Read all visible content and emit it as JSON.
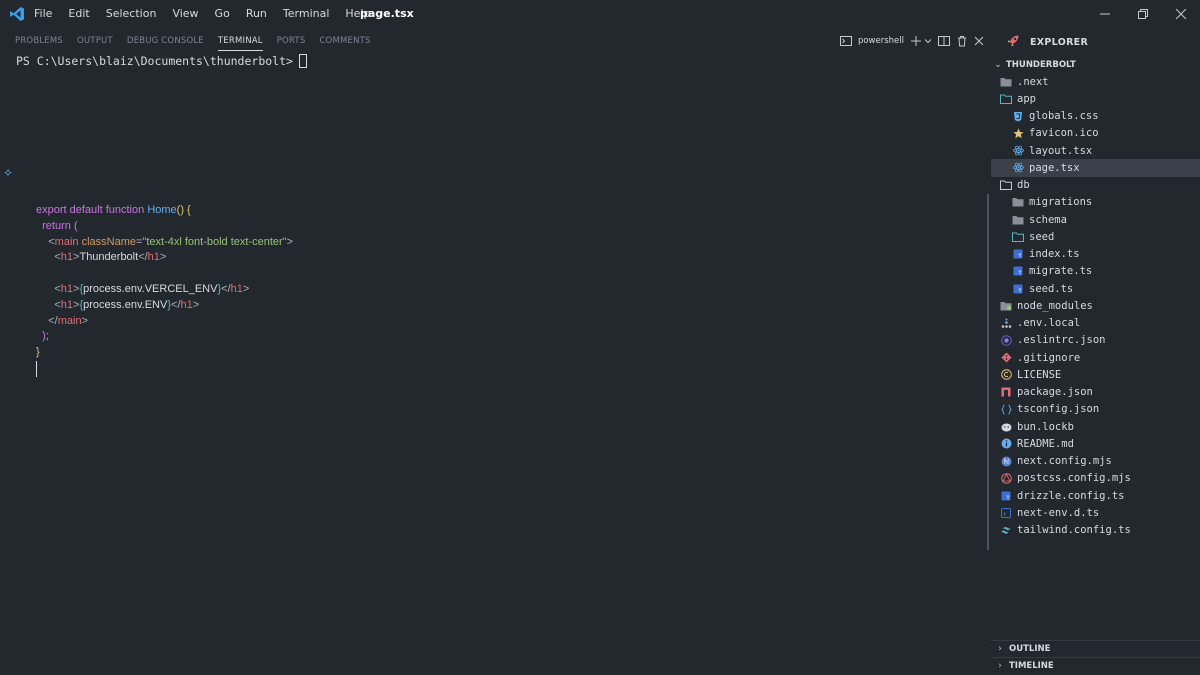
{
  "menu": [
    "File",
    "Edit",
    "Selection",
    "View",
    "Go",
    "Run",
    "Terminal",
    "Help"
  ],
  "window_title": "page.tsx",
  "panel": {
    "tabs": [
      "PROBLEMS",
      "OUTPUT",
      "DEBUG CONSOLE",
      "TERMINAL",
      "PORTS",
      "COMMENTS"
    ],
    "active_tab": "TERMINAL",
    "shell": "powershell"
  },
  "terminal": {
    "prompt": "PS C:\\Users\\blaiz\\Documents\\thunderbolt>"
  },
  "code": {
    "l1_kw": "export default function",
    "l1_fn": "Home",
    "l2_kw": "return",
    "l3_tag": "main",
    "l3_attr": "className",
    "l3_str": "\"text-4xl font-bold text-center\"",
    "l4_tag": "h1",
    "l4_text": "Thunderbolt",
    "l6_tag": "h1",
    "l6_var": "process.env.VERCEL_ENV",
    "l7_tag": "h1",
    "l7_var": "process.env.ENV",
    "l8_tag": "main"
  },
  "explorer": {
    "title": "EXPLORER",
    "project": "THUNDERBOLT",
    "items": [
      {
        "name": ".next",
        "depth": 0,
        "icon": "folder-closed-icon",
        "color": "#8a909a"
      },
      {
        "name": "app",
        "depth": 0,
        "icon": "folder-open-icon",
        "color": "#56b6c2"
      },
      {
        "name": "globals.css",
        "depth": 1,
        "icon": "css-shield-icon",
        "color": "#61afef"
      },
      {
        "name": "favicon.ico",
        "depth": 1,
        "icon": "star-icon",
        "color": "#e5c07b"
      },
      {
        "name": "layout.tsx",
        "depth": 1,
        "icon": "react-atom-icon",
        "color": "#61afef"
      },
      {
        "name": "page.tsx",
        "depth": 1,
        "icon": "react-atom-icon",
        "color": "#61afef",
        "selected": true
      },
      {
        "name": "db",
        "depth": 0,
        "icon": "folder-open-icon",
        "color": "#c5c8ce"
      },
      {
        "name": "migrations",
        "depth": 1,
        "icon": "folder-closed-icon",
        "color": "#8a909a"
      },
      {
        "name": "schema",
        "depth": 1,
        "icon": "folder-closed-icon",
        "color": "#8a909a"
      },
      {
        "name": "seed",
        "depth": 1,
        "icon": "folder-open-icon",
        "color": "#56b6c2"
      },
      {
        "name": "index.ts",
        "depth": 1,
        "icon": "ts-file-icon",
        "color": "#3b6fd4"
      },
      {
        "name": "migrate.ts",
        "depth": 1,
        "icon": "ts-file-icon",
        "color": "#3b6fd4"
      },
      {
        "name": "seed.ts",
        "depth": 1,
        "icon": "ts-file-icon",
        "color": "#3b6fd4"
      },
      {
        "name": "node_modules",
        "depth": 0,
        "icon": "node-folder-icon",
        "color": "#8a909a"
      },
      {
        "name": ".env.local",
        "depth": 0,
        "icon": "env-dots-icon",
        "color": "#c5c8ce"
      },
      {
        "name": ".eslintrc.json",
        "depth": 0,
        "icon": "eslint-icon",
        "color": "#6a5acd"
      },
      {
        "name": ".gitignore",
        "depth": 0,
        "icon": "git-diamond-icon",
        "color": "#e06c75"
      },
      {
        "name": "LICENSE",
        "depth": 0,
        "icon": "copyright-icon",
        "color": "#e5c07b"
      },
      {
        "name": "package.json",
        "depth": 0,
        "icon": "npm-icon",
        "color": "#e06c75"
      },
      {
        "name": "tsconfig.json",
        "depth": 0,
        "icon": "braces-icon",
        "color": "#61afef"
      },
      {
        "name": "bun.lockb",
        "depth": 0,
        "icon": "bun-icon",
        "color": "#d7dae0"
      },
      {
        "name": "README.md",
        "depth": 0,
        "icon": "info-icon",
        "color": "#61afef"
      },
      {
        "name": "next.config.mjs",
        "depth": 0,
        "icon": "next-icon",
        "color": "#5b7fd4"
      },
      {
        "name": "postcss.config.mjs",
        "depth": 0,
        "icon": "postcss-icon",
        "color": "#e06c75"
      },
      {
        "name": "drizzle.config.ts",
        "depth": 0,
        "icon": "ts-file-icon",
        "color": "#3b6fd4"
      },
      {
        "name": "next-env.d.ts",
        "depth": 0,
        "icon": "ts-def-icon",
        "color": "#3b6fd4"
      },
      {
        "name": "tailwind.config.ts",
        "depth": 0,
        "icon": "tailwind-icon",
        "color": "#56b6c2"
      }
    ]
  },
  "footer": {
    "outline": "OUTLINE",
    "timeline": "TIMELINE"
  }
}
